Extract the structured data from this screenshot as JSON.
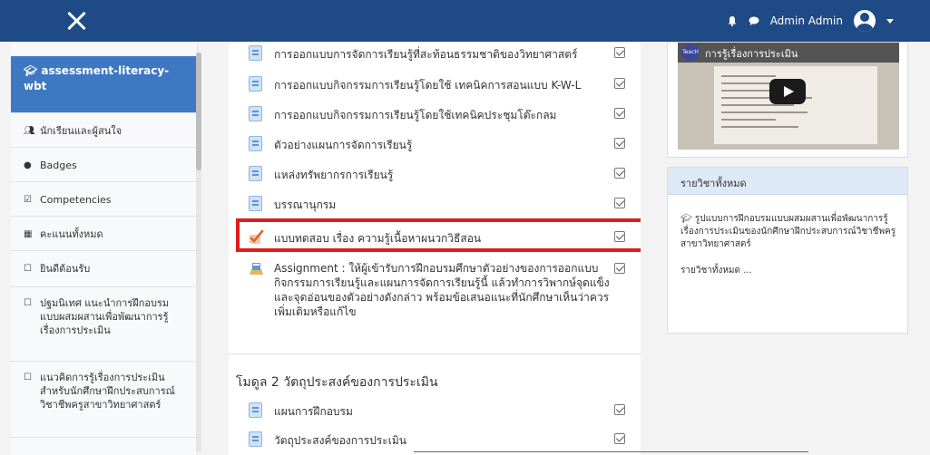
{
  "header": {
    "close_icon": "close-icon",
    "user_name": "Admin Admin"
  },
  "sidebar": {
    "course_name": "assessment-literacy-wbt",
    "items": [
      {
        "icon": "users-icon",
        "label": "นักเรียนและผู้สนใจ"
      },
      {
        "icon": "badge-icon",
        "label": "Badges"
      },
      {
        "icon": "checkbox-icon",
        "label": "Competencies"
      },
      {
        "icon": "table-icon",
        "label": "คะแนนทั้งหมด"
      },
      {
        "icon": "folder-icon",
        "label": "ยินดีต้อนรับ"
      },
      {
        "icon": "folder-icon",
        "label": "ปฐมนิเทศ แนะนำการฝึกอบรมแบบผสมผสานเพื่อพัฒนาการรู้เรื่องการประเมิน"
      },
      {
        "icon": "folder-icon",
        "label": "แนวคิดการรู้เรื่องการประเมินสำหรับนักศึกษาฝึกประสบการณ์วิชาชีพครูสาขาวิทยาศาสตร์"
      }
    ]
  },
  "main": {
    "activities": [
      {
        "type": "page",
        "label": "การออกแบบการจัดการเรียนรู้ที่สะท้อนธรรมชาติของวิทยาศาสตร์"
      },
      {
        "type": "page",
        "label": "การออกแบบกิจกรรมการเรียนรู้โดยใช้ เทคนิคการสอนแบบ K-W-L"
      },
      {
        "type": "page",
        "label": "การออกแบบกิจกรรมการเรียนรู้โดยใช้เทคนิคประชุมโต๊ะกลม"
      },
      {
        "type": "page",
        "label": "ตัวอย่างแผนการจัดการเรียนรู้"
      },
      {
        "type": "page",
        "label": "แหล่งทรัพยากรการเรียนรู้"
      },
      {
        "type": "page",
        "label": "บรรณานุกรม"
      }
    ],
    "quiz_label": "แบบทดสอบ เรื่อง ความรู้เนื้อหาผนวกวิธีสอน",
    "assignment_label": "Assignment : ให้ผู้เข้ารับการฝึกอบรมศึกษาตัวอย่างของการออกแบบกิจกรรมการเรียนรู้และแผนการจัดการเรียนรู้นี้ แล้วทำการวิพากษ์จุดแข็งและจุดอ่อนของตัวอย่างดังกล่าว พร้อมข้อเสนอแนะที่นักศึกษาเห็นว่าควรเพิ่มเติมหรือแก้ไข",
    "section2_title": "โมดูล 2 วัตถุประสงค์ของการประเมิน",
    "section2_activities": [
      {
        "type": "page",
        "label": "แผนการฝึกอบรม"
      },
      {
        "type": "page",
        "label": "วัตถุประสงค์ของการประเมิน"
      }
    ]
  },
  "right": {
    "video_title": "การรู้เรื่องการประเมิน",
    "video_logo": "TeacH",
    "block_title": "รายวิชาทั้งหมด",
    "course_link": "รูปแบบการฝึกอบรมแบบผสมผสานเพื่อพัฒนาการรู้เรื่องการประเมินของนักศึกษาฝึกประสบการณ์วิชาชีพครูสาขาวิทยาศาสตร์",
    "more_link": "รายวิชาทั้งหมด ..."
  },
  "colors": {
    "header": "#1e4a86",
    "active_nav": "#3f78c2",
    "highlight": "#e11c1c"
  }
}
